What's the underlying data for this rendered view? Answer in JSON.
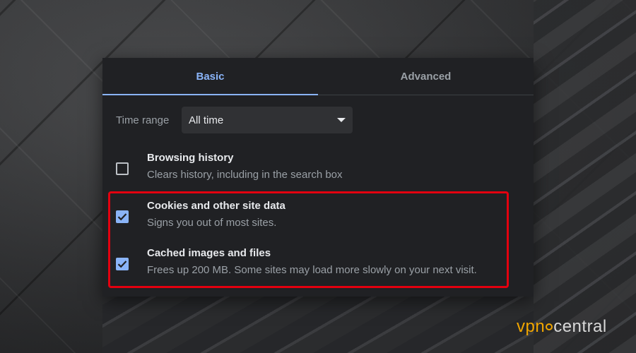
{
  "tabs": [
    {
      "label": "Basic",
      "active": true
    },
    {
      "label": "Advanced",
      "active": false
    }
  ],
  "time_range": {
    "label": "Time range",
    "selected": "All time"
  },
  "items": [
    {
      "title": "Browsing history",
      "description": "Clears history, including in the search box",
      "checked": false
    },
    {
      "title": "Cookies and other site data",
      "description": "Signs you out of most sites.",
      "checked": true
    },
    {
      "title": "Cached images and files",
      "description": "Frees up 200 MB. Some sites may load more slowly on your next visit.",
      "checked": true
    }
  ],
  "watermark": {
    "brand_left": "vpn",
    "brand_right": "central"
  },
  "colors": {
    "accent": "#8ab4f8",
    "dialog_bg": "#202124",
    "highlight": "#e3000f",
    "logo_orange": "#f0a500"
  },
  "icons": {
    "dropdown": "caret-down-icon",
    "checked": "checkmark-icon"
  }
}
